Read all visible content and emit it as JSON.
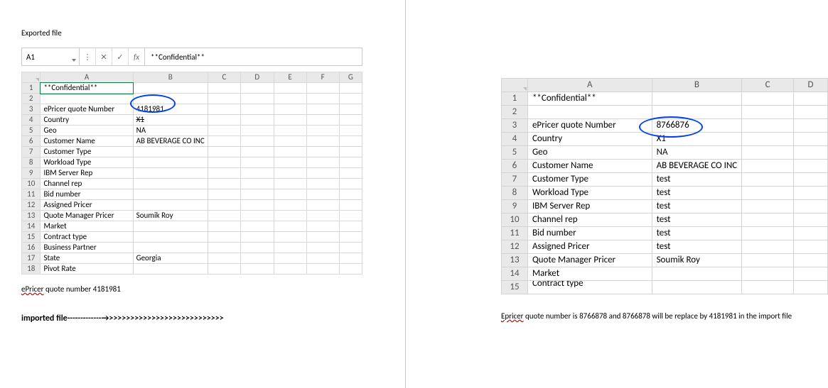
{
  "left": {
    "title": "Exported file",
    "namebox": "A1",
    "formula": "**Confidential**",
    "fx_label": "fx",
    "columns": [
      "A",
      "B",
      "C",
      "D",
      "E",
      "F",
      "G"
    ],
    "rows": [
      {
        "n": "1",
        "a": "**Confidential**",
        "b": ""
      },
      {
        "n": "2",
        "a": "",
        "b": ""
      },
      {
        "n": "3",
        "a": "ePricer quote Number",
        "b": "4181981"
      },
      {
        "n": "4",
        "a": "Country",
        "b": "X1"
      },
      {
        "n": "5",
        "a": "Geo",
        "b": "NA"
      },
      {
        "n": "6",
        "a": "Customer Name",
        "b": "AB BEVERAGE CO INC"
      },
      {
        "n": "7",
        "a": "Customer Type",
        "b": ""
      },
      {
        "n": "8",
        "a": "Workload Type",
        "b": ""
      },
      {
        "n": "9",
        "a": "IBM Server Rep",
        "b": ""
      },
      {
        "n": "10",
        "a": "Channel rep",
        "b": ""
      },
      {
        "n": "11",
        "a": "Bid number",
        "b": ""
      },
      {
        "n": "12",
        "a": "Assigned Pricer",
        "b": ""
      },
      {
        "n": "13",
        "a": "Quote Manager Pricer",
        "b": "Soumik Roy"
      },
      {
        "n": "14",
        "a": "Market",
        "b": ""
      },
      {
        "n": "15",
        "a": "Contract type",
        "b": ""
      },
      {
        "n": "16",
        "a": "Business Partner",
        "b": ""
      },
      {
        "n": "17",
        "a": "State",
        "b": "Georgia"
      },
      {
        "n": "18",
        "a": "Pivot Rate",
        "b": ""
      }
    ],
    "caption_prefix": "ePricer",
    "caption_rest": " quote number 4181981",
    "arrow_label": "imported file",
    "arrow_glyphs": "-------------→>>>>>>>>>>>>>>>>>>>>>>>>>>>"
  },
  "right": {
    "columns": [
      "A",
      "B",
      "C",
      "D"
    ],
    "rows": [
      {
        "n": "1",
        "a": "**Confidential**",
        "b": ""
      },
      {
        "n": "2",
        "a": "",
        "b": ""
      },
      {
        "n": "3",
        "a": "ePricer quote Number",
        "b": "8766876"
      },
      {
        "n": "4",
        "a": "Country",
        "b": "X1"
      },
      {
        "n": "5",
        "a": "Geo",
        "b": "NA"
      },
      {
        "n": "6",
        "a": "Customer Name",
        "b": "AB BEVERAGE CO INC"
      },
      {
        "n": "7",
        "a": "Customer Type",
        "b": "test"
      },
      {
        "n": "8",
        "a": "Workload Type",
        "b": "test"
      },
      {
        "n": "9",
        "a": "IBM Server Rep",
        "b": "test"
      },
      {
        "n": "10",
        "a": "Channel rep",
        "b": "test"
      },
      {
        "n": "11",
        "a": "Bid number",
        "b": "test"
      },
      {
        "n": "12",
        "a": "Assigned Pricer",
        "b": "test"
      },
      {
        "n": "13",
        "a": "Quote Manager Pricer",
        "b": "Soumik Roy"
      },
      {
        "n": "14",
        "a": "Market",
        "b": ""
      },
      {
        "n": "15",
        "a": "Contract type",
        "b": ""
      }
    ],
    "caption_prefix": "Epricer",
    "caption_rest": " quote number is 8766878 and 8766878 will be replace by 4181981 in the import file"
  }
}
